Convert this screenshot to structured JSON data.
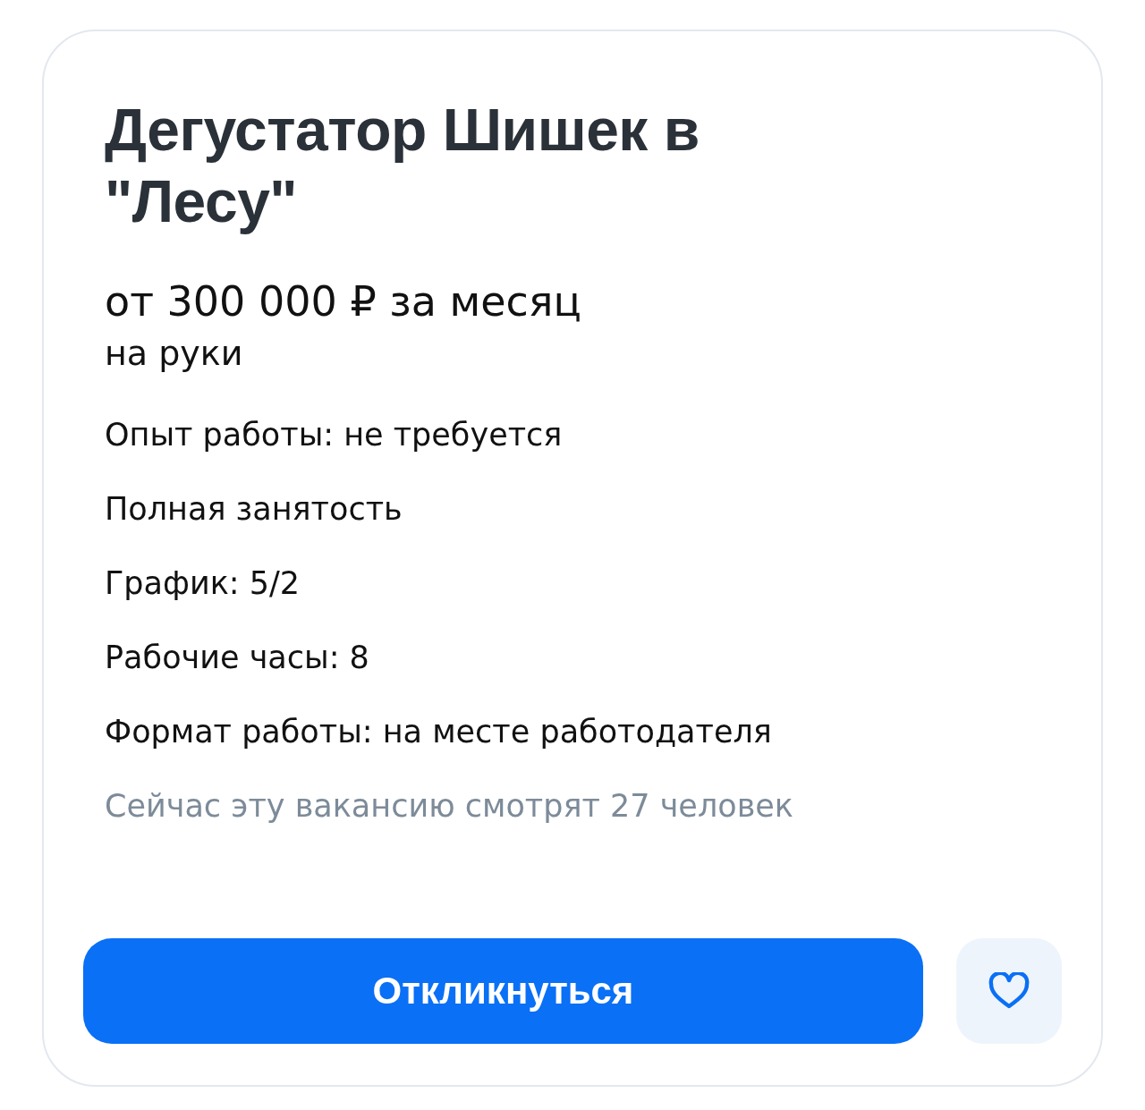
{
  "vacancy": {
    "title": "Дегустатор Шишек в \"Лесу\"",
    "salary": "от 300 000 ₽ за месяц",
    "salary_note": "на руки",
    "details": [
      "Опыт работы: не требуется",
      "Полная занятость",
      "График: 5/2",
      "Рабочие часы: 8",
      "Формат работы: на месте работодателя"
    ],
    "viewers": "Сейчас эту вакансию смотрят 27 человек",
    "apply_button": "Откликнуться"
  }
}
